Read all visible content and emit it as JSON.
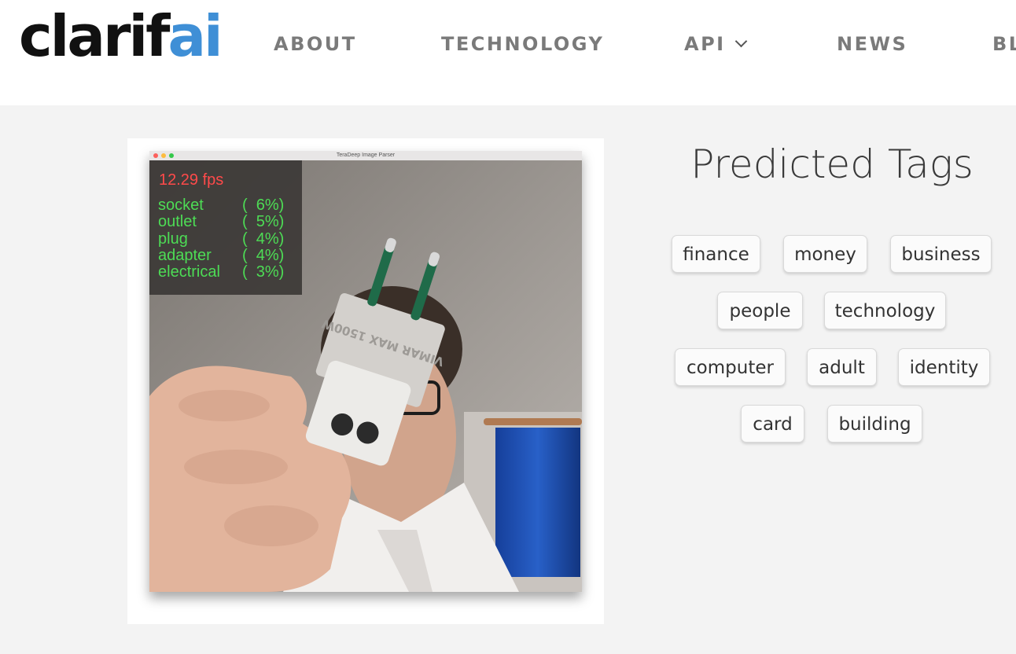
{
  "brand": {
    "logo_part1": "clarif",
    "logo_part2": "ai"
  },
  "nav": {
    "items": [
      {
        "label": "ABOUT"
      },
      {
        "label": "TECHNOLOGY"
      },
      {
        "label": "API"
      },
      {
        "label": "NEWS"
      },
      {
        "label": "BL"
      }
    ]
  },
  "demo": {
    "window_title": "TeraDeep Image Parser",
    "fps": "12.29 fps",
    "predictions": [
      {
        "label": "socket",
        "pct": "(  6%)"
      },
      {
        "label": "outlet",
        "pct": "(  5%)"
      },
      {
        "label": "plug",
        "pct": "(  4%)"
      },
      {
        "label": "adapter",
        "pct": "(  4%)"
      },
      {
        "label": "electrical",
        "pct": "(  3%)"
      }
    ],
    "plug_text": "VIMAR MAX 1500W"
  },
  "tags_panel": {
    "title": "Predicted Tags",
    "tags": [
      "finance",
      "money",
      "business",
      "people",
      "technology",
      "computer",
      "adult",
      "identity",
      "card",
      "building"
    ]
  },
  "colors": {
    "brand_blue": "#3f8fd6",
    "fps_red": "#ff4a4a",
    "prediction_green": "#4ddc55",
    "nav_gray": "#7a7a7a"
  }
}
